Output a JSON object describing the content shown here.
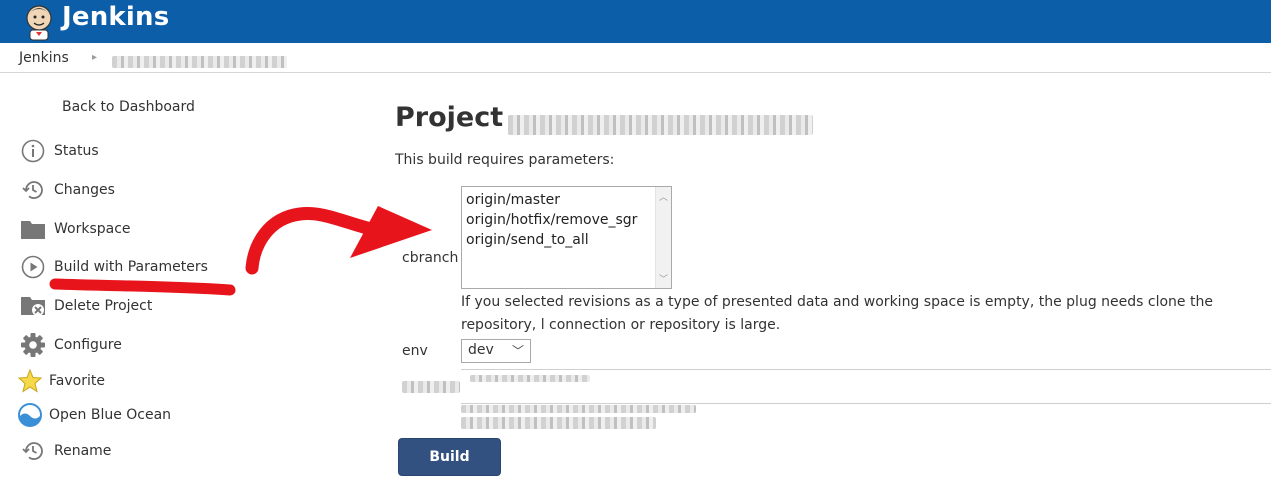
{
  "header": {
    "brand": "Jenkins"
  },
  "breadcrumb": {
    "root": "Jenkins",
    "separator": "▸"
  },
  "sidebar": {
    "back": "Back to Dashboard",
    "items": [
      {
        "label": "Status",
        "icon": "info-icon"
      },
      {
        "label": "Changes",
        "icon": "history-icon"
      },
      {
        "label": "Workspace",
        "icon": "folder-icon"
      },
      {
        "label": "Build with Parameters",
        "icon": "play-icon"
      },
      {
        "label": "Delete Project",
        "icon": "folder-delete-icon"
      },
      {
        "label": "Configure",
        "icon": "gear-icon"
      },
      {
        "label": "Favorite",
        "icon": "star-icon"
      },
      {
        "label": "Open Blue Ocean",
        "icon": "blue-ocean-icon"
      },
      {
        "label": "Rename",
        "icon": "history-icon"
      }
    ]
  },
  "main": {
    "title_prefix": "Project",
    "requires": "This build requires parameters:",
    "params": {
      "cbranch": {
        "label": "cbranch",
        "options": [
          "origin/master",
          "origin/hotfix/remove_sgr",
          "origin/send_to_all"
        ],
        "help": "If you selected revisions as a type of presented data and working space is empty, the plug needs clone the repository, l connection or repository is large."
      },
      "env": {
        "label": "env",
        "value": "dev"
      }
    },
    "build_button": "Build"
  },
  "colors": {
    "header_bg": "#0b5ea7",
    "button_bg": "#335180",
    "annotation_red": "#e8141c"
  }
}
